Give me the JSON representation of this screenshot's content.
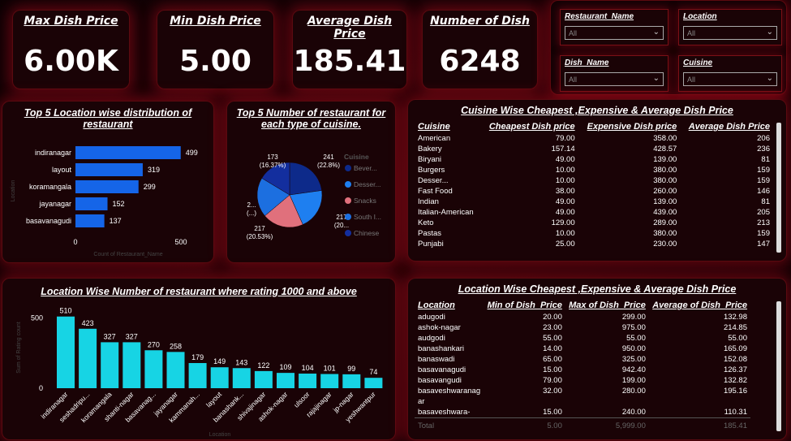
{
  "kpis": [
    {
      "title": "Max Dish Price",
      "value": "6.00K"
    },
    {
      "title": "Min Dish Price",
      "value": "5.00"
    },
    {
      "title": "Average Dish Price",
      "value": "185.41"
    },
    {
      "title": "Number of Dish",
      "value": "6248"
    }
  ],
  "slicers": [
    {
      "label": "Restaurant_Name",
      "value": "All"
    },
    {
      "label": "Location",
      "value": "All"
    },
    {
      "label": "Dish_Name",
      "value": "All"
    },
    {
      "label": "Cuisine",
      "value": "All"
    }
  ],
  "location_chart": {
    "title": "Top 5 Location wise distribution of restaurant",
    "xlabel": "Count of Restaurant_Name",
    "ylabel": "Location",
    "ticks": [
      "0",
      "500"
    ]
  },
  "cuisine_pie": {
    "title": "Top 5 Number of restaurant for each type of cuisine.",
    "legend_title": "Cuisine",
    "labels": [
      {
        "line1": "241",
        "line2": "(22.8%)"
      },
      {
        "line1": "217",
        "line2": "(20..."
      },
      {
        "line1": "217",
        "line2": "(20.53%)"
      },
      {
        "line1": "2...",
        "line2": "(...)"
      },
      {
        "line1": "173",
        "line2": "(16.37%)"
      }
    ]
  },
  "cuisine_table": {
    "title": "Cuisine Wise Cheapest ,Expensive & Average Dish Price",
    "headers": [
      "Cuisine",
      "Cheapest Dish price",
      "Expensive Dish price",
      "Average Dish Price"
    ],
    "rows": [
      [
        "American",
        "79.00",
        "358.00",
        "206"
      ],
      [
        "Bakery",
        "157.14",
        "428.57",
        "236"
      ],
      [
        "Biryani",
        "49.00",
        "139.00",
        "81"
      ],
      [
        "Burgers",
        "10.00",
        "380.00",
        "159"
      ],
      [
        "Desser...",
        "10.00",
        "380.00",
        "159"
      ],
      [
        "Fast Food",
        "38.00",
        "260.00",
        "146"
      ],
      [
        "Indian",
        "49.00",
        "139.00",
        "81"
      ],
      [
        "Italian-American",
        "49.00",
        "439.00",
        "205"
      ],
      [
        "Keto",
        "129.00",
        "289.00",
        "213"
      ],
      [
        "Pastas",
        "10.00",
        "380.00",
        "159"
      ],
      [
        "Punjabi",
        "25.00",
        "230.00",
        "147"
      ]
    ]
  },
  "rating_chart": {
    "title": "Location Wise Number of restaurant where rating 1000 and above",
    "xlabel": "Location",
    "ylabel": "Sum of Rating count",
    "yticks": [
      "500",
      "0"
    ]
  },
  "location_table": {
    "title": "Location Wise Cheapest ,Expensive & Average Dish Price",
    "headers": [
      "Location",
      "Min of Dish_Price",
      "Max of Dish_Price",
      "Average of Dish_Price"
    ],
    "rows": [
      [
        "adugodi",
        "20.00",
        "299.00",
        "132.98"
      ],
      [
        "ashok-nagar",
        "23.00",
        "975.00",
        "214.85"
      ],
      [
        "audgodi",
        "55.00",
        "55.00",
        "55.00"
      ],
      [
        "banashankari",
        "14.00",
        "950.00",
        "165.09"
      ],
      [
        "banaswadi",
        "65.00",
        "325.00",
        "152.08"
      ],
      [
        "basavanagudi",
        "15.00",
        "942.40",
        "126.37"
      ],
      [
        "basavangudi",
        "79.00",
        "199.00",
        "132.82"
      ],
      [
        "basaveshwaranag",
        "32.00",
        "280.00",
        "195.16"
      ],
      [
        "ar",
        "",
        "",
        ""
      ],
      [
        "basaveshwara-",
        "15.00",
        "240.00",
        "110.31"
      ]
    ],
    "total": [
      "Total",
      "5.00",
      "5,999.00",
      "185.41"
    ]
  },
  "chart_data": [
    {
      "type": "bar",
      "orientation": "horizontal",
      "title": "Top 5 Location wise distribution of restaurant",
      "xlabel": "Count of Restaurant_Name",
      "ylabel": "Location",
      "categories": [
        "indiranagar",
        "layout",
        "koramangala",
        "jayanagar",
        "basavanagudi"
      ],
      "values": [
        499,
        319,
        299,
        152,
        137
      ],
      "xlim": [
        0,
        500
      ],
      "color": "#1565e8"
    },
    {
      "type": "pie",
      "title": "Top 5 Number of restaurant for each type of cuisine.",
      "legend": [
        "Bever...",
        "Desser...",
        "Snacks",
        "South I...",
        "Chinese"
      ],
      "values": [
        241,
        217,
        217,
        209,
        173
      ],
      "colors": [
        "#0d2a8a",
        "#1e7ff0",
        "#e0707c",
        "#1c6fe0",
        "#132e9e"
      ]
    },
    {
      "type": "bar",
      "title": "Location Wise Number of restaurant where rating 1000 and above",
      "xlabel": "Location",
      "ylabel": "Sum of Rating count",
      "categories": [
        "indiranagar",
        "seshadripu...",
        "koramangala",
        "shanti-nagar",
        "basavanag...",
        "jayanagar",
        "kammanah...",
        "layout",
        "banashank...",
        "shivajinagar",
        "ashok-nagar",
        "ulsoor",
        "rajajinagar",
        "jp-nagar",
        "yeshwantpur"
      ],
      "values": [
        510,
        423,
        327,
        327,
        270,
        258,
        179,
        149,
        143,
        122,
        109,
        104,
        101,
        99,
        74
      ],
      "ylim": [
        0,
        520
      ],
      "color": "#17d4e4"
    }
  ]
}
